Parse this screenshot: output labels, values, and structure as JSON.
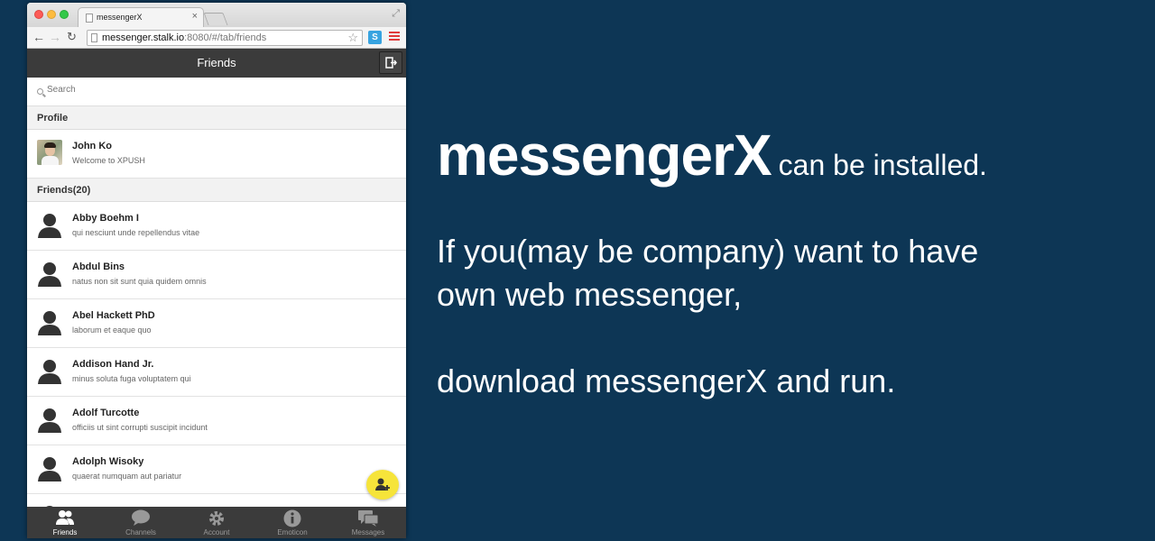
{
  "browser": {
    "tab_title": "messengerX",
    "tab_close": "×",
    "url_host": "messenger.stalk.io",
    "url_rest": ":8080/#/tab/friends",
    "ext_label": "S"
  },
  "app": {
    "header_title": "Friends",
    "search_placeholder": "Search",
    "profile_section": "Profile",
    "profile": {
      "name": "John Ko",
      "message": "Welcome to XPUSH"
    },
    "friends_section": "Friends(20)",
    "friends": [
      {
        "name": "Abby Boehm I",
        "message": "qui nesciunt unde repellendus vitae"
      },
      {
        "name": "Abdul Bins",
        "message": "natus non sit sunt quia quidem omnis"
      },
      {
        "name": "Abel Hackett PhD",
        "message": "laborum et eaque quo"
      },
      {
        "name": "Addison Hand Jr.",
        "message": "minus soluta fuga voluptatem qui"
      },
      {
        "name": "Adolf Turcotte",
        "message": "officiis ut sint corrupti suscipit incidunt"
      },
      {
        "name": "Adolph Wisoky",
        "message": "quaerat numquam aut pariatur"
      }
    ],
    "tabs": [
      {
        "label": "Friends",
        "icon": "friends-icon",
        "active": true
      },
      {
        "label": "Channels",
        "icon": "channels-icon",
        "active": false
      },
      {
        "label": "Account",
        "icon": "gear-icon",
        "active": false
      },
      {
        "label": "Emoticon",
        "icon": "info-icon",
        "active": false
      },
      {
        "label": "Messages",
        "icon": "messages-icon",
        "active": false
      }
    ]
  },
  "promo": {
    "title": "messengerX",
    "title_suffix": "can be installed.",
    "line1": "If you(may be company) want to have",
    "line2": "own web messenger,",
    "line3": "download messengerX and run."
  },
  "colors": {
    "background": "#0d3655",
    "app_bar": "#3b3b3b",
    "fab": "#f6e43a"
  }
}
